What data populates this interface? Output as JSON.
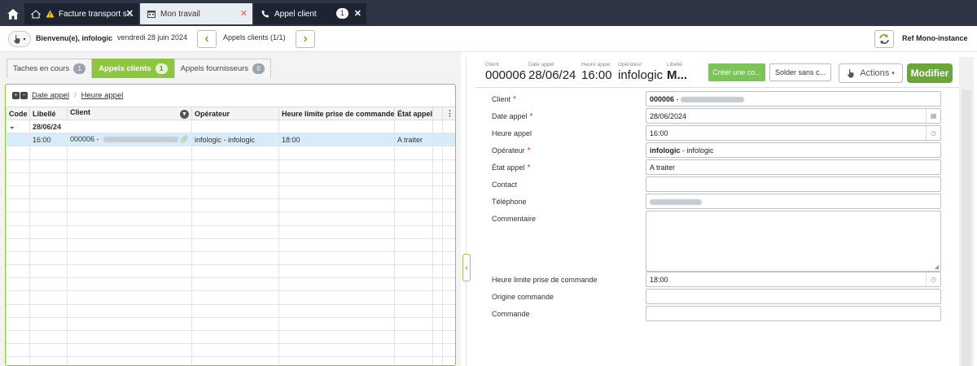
{
  "tabs": [
    {
      "label": "Facture transport s...",
      "icon": "home-warning-icon"
    },
    {
      "label": "Mon travail",
      "icon": "calendar-icon"
    },
    {
      "label": "Appel client",
      "icon": "phone-icon",
      "badge": "1"
    }
  ],
  "toolbar": {
    "welcome": "Bienvenu(e), infologic",
    "date": "vendredi 28 juin 2024",
    "nav_label": "Appels clients (1/1)",
    "ref_label": "Ref Mono-instance"
  },
  "subtabs": [
    {
      "label": "Taches en cours",
      "count": "1"
    },
    {
      "label": "Appels clients",
      "count": "1",
      "active": true
    },
    {
      "label": "Appels fournisseurs",
      "count": "0"
    }
  ],
  "grouping": {
    "first": "Date appel",
    "second": "Heure appel"
  },
  "grid": {
    "columns": [
      "Code",
      "Libellé",
      "Client",
      "Opérateur",
      "Heure limite prise de commande",
      "État appel"
    ],
    "group_label": "28/06/24",
    "rows": [
      {
        "code": "",
        "libelle": "16:00",
        "client": "000006 -",
        "operateur": "infologic - infologic",
        "heure_limite": "18:00",
        "etat": "A traiter"
      }
    ]
  },
  "record_header": {
    "client_label": "Client",
    "client_value": "000006",
    "date_label": "Date appel",
    "date_value": "28/06/24",
    "heure_label": "Heure appel",
    "heure_value": "16:00",
    "operateur_label": "Opérateur",
    "operateur_value": "infologic",
    "libelle_label": "Libellé",
    "libelle_value": "M..."
  },
  "buttons": {
    "creer": "Créer une co...",
    "solder": "Solder sans c...",
    "actions": "Actions",
    "modifier": "Modifier"
  },
  "form": {
    "client": {
      "label": "Client",
      "value": "000006",
      "suffix": " - "
    },
    "date_appel": {
      "label": "Date appel",
      "value": "28/06/2024"
    },
    "heure_appel": {
      "label": "Heure appel",
      "value": "16:00"
    },
    "operateur": {
      "label": "Opérateur",
      "value": "infologic",
      "suffix": " - infologic"
    },
    "etat_appel": {
      "label": "État appel",
      "value": "A traiter"
    },
    "contact": {
      "label": "Contact",
      "value": ""
    },
    "telephone": {
      "label": "Téléphone",
      "value": ""
    },
    "commentaire": {
      "label": "Commentaire",
      "value": ""
    },
    "heure_limite": {
      "label": "Heure limite prise de commande",
      "value": "18:00"
    },
    "origine_commande": {
      "label": "Origine commande",
      "value": ""
    },
    "commande": {
      "label": "Commande",
      "value": ""
    }
  },
  "colors": {
    "tabbar": "#2e3645",
    "accent_green": "#8dc73f",
    "modifier_green": "#6aa638",
    "required": "#d9342b",
    "selected_row": "#d7ecf8"
  }
}
